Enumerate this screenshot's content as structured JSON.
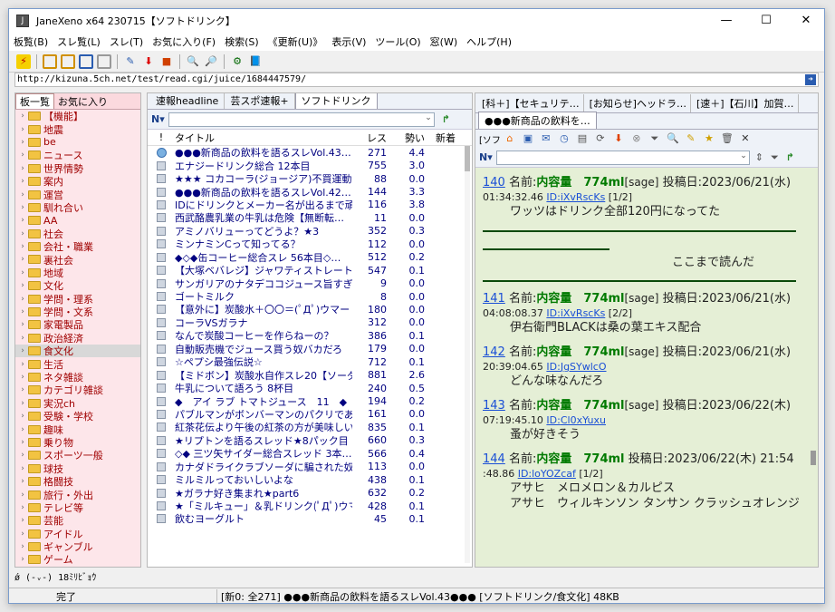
{
  "window": {
    "title": "JaneXeno x64 230715【ソフトドリンク】",
    "min": "—",
    "max": "☐",
    "close": "✕"
  },
  "menu": [
    "板覧(B)",
    "スレ覧(L)",
    "スレ(T)",
    "お気に入り(F)",
    "検索(S)",
    "《更新(U)》",
    "表示(V)",
    "ツール(O)",
    "窓(W)",
    "ヘルプ(H)"
  ],
  "address": {
    "url": "http://kizuna.5ch.net/test/read.cgi/juice/1684447579/"
  },
  "tree": {
    "tabs": [
      "板一覧",
      "お気に入り"
    ],
    "items": [
      "【機能】",
      "地震",
      "be",
      "ニュース",
      "世界情勢",
      "案内",
      "運営",
      "馴れ合い",
      "AA",
      "社会",
      "会社・職業",
      "裏社会",
      "地域",
      "文化",
      "学問・理系",
      "学問・文系",
      "家電製品",
      "政治経済",
      "食文化",
      "生活",
      "ネタ雑談",
      "カテゴリ雑談",
      "実況ch",
      "受験・学校",
      "趣味",
      "乗り物",
      "スポーツ一般",
      "球技",
      "格闘技",
      "旅行・外出",
      "テレビ等",
      "芸能",
      "アイドル",
      "ギャンブル",
      "ゲーム"
    ],
    "selected": "食文化"
  },
  "threadlist": {
    "tabs": [
      "速報headline",
      "芸スポ速報+",
      "ソフトドリンク"
    ],
    "columns": [
      "!",
      "タイトル",
      "レス",
      "勢い",
      "新着"
    ],
    "rows": [
      {
        "title": "●●●新商品の飲料を語るスレVol.43…",
        "res": "271",
        "ikioi": "4.4"
      },
      {
        "title": "エナジードリンク総合 12本目",
        "res": "755",
        "ikioi": "3.0"
      },
      {
        "title": "★★★ コカコーラ(ジョージア)不買運動…",
        "res": "88",
        "ikioi": "0.0"
      },
      {
        "title": "●●●新商品の飲料を語るスレVol.42…",
        "res": "144",
        "ikioi": "3.3"
      },
      {
        "title": "IDにドリンクとメーカー名が出るまで頑張る…",
        "res": "116",
        "ikioi": "3.8"
      },
      {
        "title": "西武酪農乳業の牛乳は危険【無断転…",
        "res": "11",
        "ikioi": "0.0"
      },
      {
        "title": "アミノバリューってどうよ？★3",
        "res": "352",
        "ikioi": "0.3"
      },
      {
        "title": "ミンナミンCって知ってる？",
        "res": "112",
        "ikioi": "0.0"
      },
      {
        "title": "◆◇◆缶コーヒー総合スレ 56本目◇…",
        "res": "512",
        "ikioi": "0.2"
      },
      {
        "title": "【大塚ベバレジ】ジャワティストレート / JA…",
        "res": "547",
        "ikioi": "0.1"
      },
      {
        "title": "サンガリアのナタデココジュース旨すぎ【無…",
        "res": "9",
        "ikioi": "0.0"
      },
      {
        "title": "ゴートミルク",
        "res": "8",
        "ikioi": "0.0"
      },
      {
        "title": "【意外に】炭酸水＋〇〇＝(ﾟДﾟ)ウマー【ウ…",
        "res": "180",
        "ikioi": "0.0"
      },
      {
        "title": "コーラVSガラナ",
        "res": "312",
        "ikioi": "0.0"
      },
      {
        "title": "なんで炭酸コーヒーを作らねーの？",
        "res": "386",
        "ikioi": "0.1"
      },
      {
        "title": "自動販売機でジュース買う奴バカだろ",
        "res": "179",
        "ikioi": "0.0"
      },
      {
        "title": "☆ペプシ最強伝説☆",
        "res": "712",
        "ikioi": "0.1"
      },
      {
        "title": "【ミドボン】炭酸水自作スレ20【ソーダサイ…",
        "res": "881",
        "ikioi": "2.6"
      },
      {
        "title": "牛乳について語ろう 8杯目",
        "res": "240",
        "ikioi": "0.5"
      },
      {
        "title": "◆　アイ ラブ トマトジュース　11　◆［",
        "res": "194",
        "ikioi": "0.2"
      },
      {
        "title": "パブルマンがボンバーマンのパクリである件",
        "res": "161",
        "ikioi": "0.0"
      },
      {
        "title": "紅茶花伝より午後の紅茶の方が美味しい",
        "res": "835",
        "ikioi": "0.1"
      },
      {
        "title": "★リプトンを語るスレッド★8パック目",
        "res": "660",
        "ikioi": "0.3"
      },
      {
        "title": "◇◆ 三ツ矢サイダー総合スレッド 3本…",
        "res": "566",
        "ikioi": "0.4"
      },
      {
        "title": "カナダドライクラブソーダに騙された奴の数…",
        "res": "113",
        "ikioi": "0.0"
      },
      {
        "title": "ミルミルっておいしいよな",
        "res": "438",
        "ikioi": "0.1"
      },
      {
        "title": "★ガラナ好き集まれ★part6",
        "res": "632",
        "ikioi": "0.2"
      },
      {
        "title": "★「ミルキュー」＆乳ドリンク(ﾟДﾟ)ウマー ★",
        "res": "428",
        "ikioi": "0.1"
      },
      {
        "title": "飲むヨーグルト",
        "res": "45",
        "ikioi": "0.1"
      }
    ]
  },
  "threadview": {
    "tabs": [
      "[科＋]【セキュリテ…",
      "[お知らせ]ヘッドラ…",
      "[速＋]【石川】加賀…"
    ],
    "active_tab": "●●●新商品の飲料を…",
    "tool_label": "[ソフ",
    "readmark": "ここまで読んだ",
    "posts": [
      {
        "num": "140",
        "label": "名前:",
        "name": "内容量　774ml",
        "mail": "[sage]",
        "date": "投稿日:2023/06/21(水)",
        "time": "01:34:32.46",
        "id_label": "ID:",
        "id": "iXvRscKs",
        "count": "[1/2]",
        "body": [
          "ワッツはドリンク全部120円になってた"
        ]
      },
      {
        "num": "141",
        "label": "名前:",
        "name": "内容量　774ml",
        "mail": "[sage]",
        "date": "投稿日:2023/06/21(水)",
        "time": "04:08:08.37",
        "id_label": "ID:",
        "id": "iXvRscKs",
        "count": "[2/2]",
        "body": [
          "伊右衛門BLACKは桑の葉エキス配合"
        ]
      },
      {
        "num": "142",
        "label": "名前:",
        "name": "内容量　774ml",
        "mail": "[sage]",
        "date": "投稿日:2023/06/21(水)",
        "time": "20:39:04.65",
        "id_label": "ID:",
        "id": "JgSYwlcO",
        "count": "",
        "body": [
          "どんな味なんだろ"
        ]
      },
      {
        "num": "143",
        "label": "名前:",
        "name": "内容量　774ml",
        "mail": "[sage]",
        "date": "投稿日:2023/06/22(木)",
        "time": "07:19:45.10",
        "id_label": "ID:",
        "id": "Cl0xYuxu",
        "count": "",
        "body": [
          "蚤が好きそう"
        ]
      },
      {
        "num": "144",
        "label": "名前:",
        "name": "内容量　774ml",
        "mail": "",
        "date": "投稿日:2023/06/22(木) 21:54",
        "time": ":48.86",
        "id_label": "ID:",
        "id": "loYOZcaf",
        "count": "[1/2]",
        "body": [
          "アサヒ　メロメロン＆カルピス",
          "アサヒ　ウィルキンソン タンサン クラッシュオレンジ"
        ]
      }
    ]
  },
  "cmdline": "ǿ (-ᵥ-) 18ﾐﾘﾋﾞｮｳ",
  "status": {
    "left": "完了",
    "right": "[新0: 全271] ●●●新商品の飲料を語るスレVol.43●●●  [ソフトドリンク/食文化]  48KB"
  },
  "colors": {
    "tree_bg": "#fde6ea",
    "view_bg": "#e5efd6",
    "name": "#007a00",
    "link": "#1a4fd6",
    "tree_text": "#a00000"
  }
}
